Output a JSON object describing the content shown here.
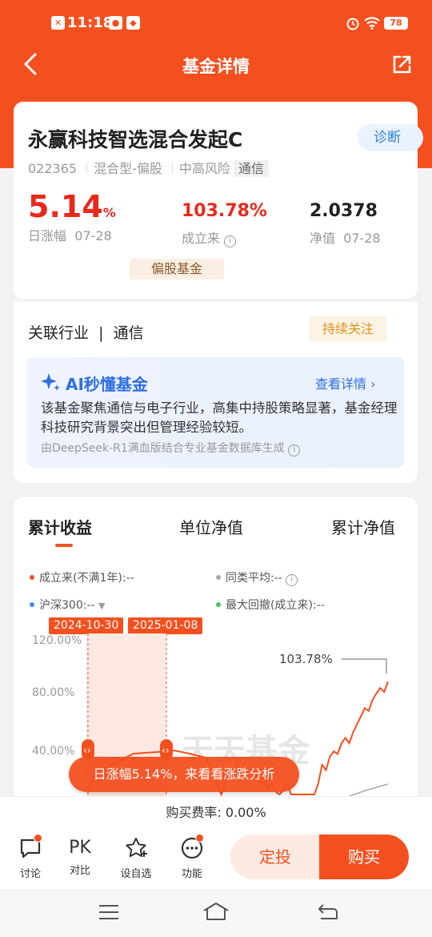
{
  "status": {
    "time": "11:18",
    "battery": "78"
  },
  "nav": {
    "title": "基金详情"
  },
  "fund": {
    "name": "永赢科技智选混合发起C",
    "code": "022365",
    "type": "混合型-偏股",
    "risk": "中高风险",
    "sector_tag": "通信",
    "diagnose_label": "诊断",
    "daily_change": "5.14",
    "daily_change_unit": "%",
    "daily_label": "日涨幅",
    "daily_date": "07-28",
    "since_inception": "103.78%",
    "since_label": "成立来",
    "nav": "2.0378",
    "nav_label": "净值",
    "nav_date": "07-28",
    "category_pill": "偏股基金"
  },
  "industry": {
    "label": "关联行业",
    "sep": "|",
    "value": "通信",
    "follow": "持续关注"
  },
  "ai": {
    "title": "AI秒懂基金",
    "more": "查看详情 ›",
    "text": "该基金聚焦通信与电子行业，高集中持股策略显著，基金经理科技研究背景突出但管理经验较短。",
    "source": "由DeepSeek-R1满血版结合专业基金数据库生成"
  },
  "chart_tabs": [
    "累计收益",
    "单位净值",
    "累计净值"
  ],
  "legend": {
    "since": "成立来(不满1年):",
    "since_val": "--",
    "peer": "同类平均:",
    "peer_val": "--",
    "hs300": "沪深300:",
    "hs300_val": "--",
    "drawdown": "最大回撤(成立来):",
    "drawdown_val": "--"
  },
  "colors": {
    "accent": "#f4501f",
    "since": "#f4501f",
    "peer": "#aaaaaa",
    "hs300": "#3a8ee6",
    "drawdown": "#46c35a"
  },
  "chart_data": {
    "type": "line",
    "yticks": [
      "120.00%",
      "80.00%",
      "40.00%"
    ],
    "ylim": [
      0,
      130
    ],
    "highlight": [
      "2024-10-30",
      "2025-01-08"
    ],
    "end_label": "103.78%",
    "watermark": "天天基金",
    "series": [
      {
        "values": [
          -40,
          -20,
          10,
          28,
          32,
          38,
          42,
          36,
          39,
          34,
          38,
          32,
          28,
          33,
          24,
          28,
          22,
          18,
          23,
          28,
          15,
          12,
          8,
          5,
          2,
          5,
          12,
          28,
          42,
          38,
          48,
          52,
          50,
          58,
          62,
          58,
          66,
          72,
          78,
          84,
          82,
          90,
          95,
          99,
          96,
          103.78
        ]
      }
    ]
  },
  "float_tip": "日涨幅5.14%，来看看涨跌分析",
  "fee": {
    "label": "购买费率:",
    "value": "0.00%"
  },
  "bottom": {
    "items": [
      "讨论",
      "对比",
      "设自选",
      "功能"
    ],
    "pk": "PK",
    "ding": "定投",
    "buy": "购买"
  }
}
